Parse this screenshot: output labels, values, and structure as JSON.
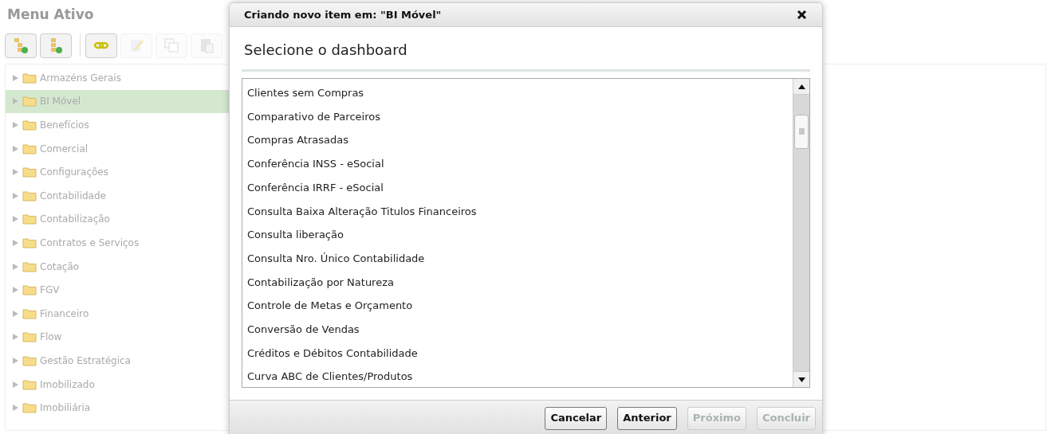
{
  "page": {
    "title": "Menu Ativo"
  },
  "toolbar": [
    {
      "kind": "tree-add",
      "disabled": false
    },
    {
      "kind": "list-add",
      "disabled": false
    },
    {
      "kind": "link",
      "disabled": false
    },
    {
      "kind": "edit",
      "disabled": true
    },
    {
      "kind": "copy",
      "disabled": true
    },
    {
      "kind": "paste",
      "disabled": true
    }
  ],
  "tree": [
    {
      "label": "Armazéns Gerais",
      "selected": false
    },
    {
      "label": "BI Móvel",
      "selected": true
    },
    {
      "label": "Benefícios",
      "selected": false
    },
    {
      "label": "Comercial",
      "selected": false
    },
    {
      "label": "Configurações",
      "selected": false
    },
    {
      "label": "Contabilidade",
      "selected": false
    },
    {
      "label": "Contabilização",
      "selected": false
    },
    {
      "label": "Contratos e Serviços",
      "selected": false
    },
    {
      "label": "Cotação",
      "selected": false
    },
    {
      "label": "FGV",
      "selected": false
    },
    {
      "label": "Financeiro",
      "selected": false
    },
    {
      "label": "Flow",
      "selected": false
    },
    {
      "label": "Gestão Estratégica",
      "selected": false
    },
    {
      "label": "Imobilizado",
      "selected": false
    },
    {
      "label": "Imobiliária",
      "selected": false
    }
  ],
  "dialog": {
    "title": "Criando novo item em: \"BI Móvel\"",
    "heading": "Selecione o dashboard",
    "items": [
      "Clientes sem Compras",
      "Comparativo de Parceiros",
      "Compras Atrasadas",
      "Conferência INSS - eSocial",
      "Conferência IRRF - eSocial",
      "Consulta Baixa Alteração Titulos Financeiros",
      "Consulta liberação",
      "Consulta Nro. Único Contabilidade",
      "Contabilização por Natureza",
      "Controle de Metas e Orçamento",
      "Conversão de Vendas",
      "Créditos e Débitos Contabilidade",
      "Curva ABC de Clientes/Produtos"
    ],
    "buttons": [
      {
        "label": "Cancelar",
        "disabled": false
      },
      {
        "label": "Anterior",
        "disabled": false
      },
      {
        "label": "Próximo",
        "disabled": true
      },
      {
        "label": "Concluir",
        "disabled": true
      }
    ]
  }
}
